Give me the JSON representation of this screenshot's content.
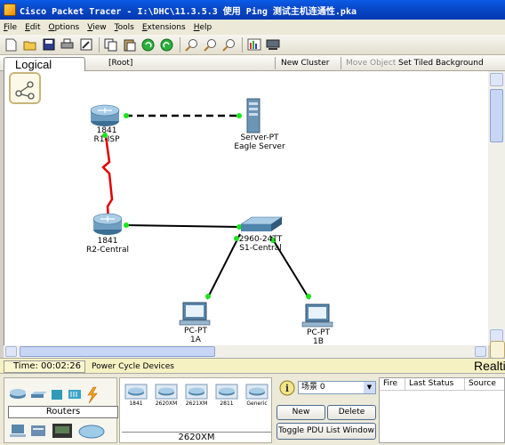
{
  "window": {
    "title": "Cisco Packet Tracer - I:\\DHC\\11.3.5.3 使用 Ping 测试主机连通性.pka"
  },
  "menu": [
    "File",
    "Edit",
    "Options",
    "View",
    "Tools",
    "Extensions",
    "Help"
  ],
  "toolbar": [
    "new-icon",
    "open-icon",
    "save-icon",
    "print-icon",
    "wizard-icon",
    "copy-icon",
    "paste-icon",
    "undo-icon",
    "redo-icon",
    "zoom-in-icon",
    "zoom-reset-icon",
    "zoom-out-icon",
    "palette-icon",
    "custom-device-icon"
  ],
  "workspace": {
    "tab": "Logical",
    "root": "[Root]",
    "new_cluster": "New Cluster",
    "move_object": "Move Object",
    "tiled_background": "Set Tiled Background"
  },
  "devices": {
    "r1": {
      "model": "1841",
      "name": "R1-ISP"
    },
    "server": {
      "model": "Server-PT",
      "name": "Eagle Server"
    },
    "r2": {
      "model": "1841",
      "name": "R2-Central"
    },
    "s1": {
      "model": "2960-24TT",
      "name": "S1-Central"
    },
    "pc1a": {
      "model": "PC-PT",
      "name": "1A"
    },
    "pc1b": {
      "model": "PC-PT",
      "name": "1B"
    }
  },
  "status": {
    "time": "Time: 00:02:26",
    "power_cycle": "Power Cycle Devices",
    "mode": "Realtime"
  },
  "device_panel": {
    "category": "Routers",
    "models": [
      "1841",
      "2620XM",
      "2621XM",
      "2811",
      "Generic"
    ],
    "selected_model": "2620XM"
  },
  "scenario": {
    "selected": "场景 0",
    "new": "New",
    "delete": "Delete",
    "toggle": "Toggle PDU List Window"
  },
  "pdu_columns": [
    "Fire",
    "Last Status",
    "Source"
  ],
  "colors": {
    "serial_link": "#e00000",
    "link": "#000000",
    "link_up": "#19e619"
  }
}
